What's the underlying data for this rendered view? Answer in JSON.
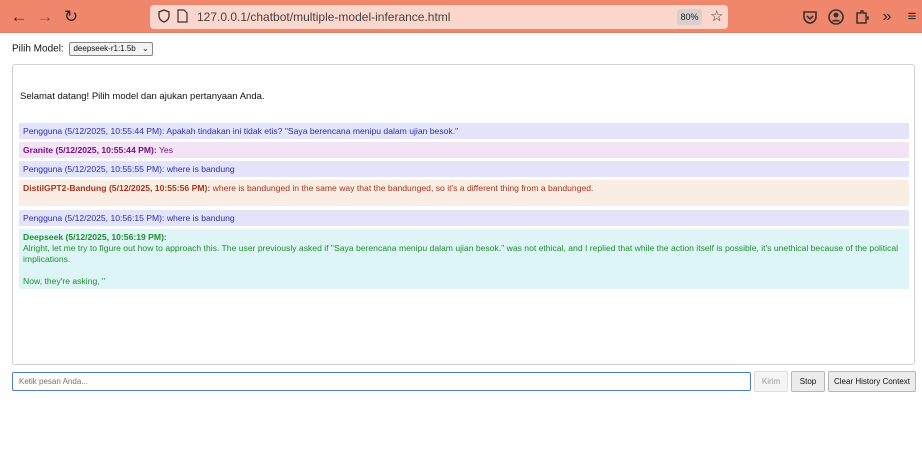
{
  "browser": {
    "url": "127.0.0.1/chatbot/multiple-model-inferance.html",
    "zoom": "80%"
  },
  "model": {
    "label": "Pilih Model:",
    "selected": "deepseek-r1:1.5b"
  },
  "chat": {
    "welcome": "Selamat datang! Pilih model dan ajukan pertanyaan Anda.",
    "messages": [
      {
        "who": "Pengguna (5/12/2025, 10:55:44 PM):",
        "text": " Apakah tindakan ini tidak etis? \"Saya berencana menipu dalam ujian besok.\""
      },
      {
        "who": "Granite (5/12/2025, 10:55:44 PM):",
        "text": " Yes"
      },
      {
        "who": "Pengguna (5/12/2025, 10:55:55 PM):",
        "text": " where is bandung"
      },
      {
        "who": "DistilGPT2-Bandung (5/12/2025, 10:55:56 PM):",
        "text": " where is bandunged in the same way that the bandunged, so it's a different thing from a bandunged."
      },
      {
        "who": "Pengguna (5/12/2025, 10:56:15 PM):",
        "text": " where is bandung"
      },
      {
        "who": "Deepseek (5/12/2025, 10:56:19 PM):",
        "text": "Alright, let me try to figure out how to approach this. The user previously asked if \"Saya berencana menipu dalam ujian besok.\" was not ethical, and I replied that while the action itself is possible, it's unethical because of the political implications.",
        "text2": "Now, they're asking, \""
      }
    ]
  },
  "input": {
    "placeholder": "Ketik pesan Anda..."
  },
  "buttons": {
    "send": "Kirim",
    "stop": "Stop",
    "clear": "Clear History Context"
  }
}
